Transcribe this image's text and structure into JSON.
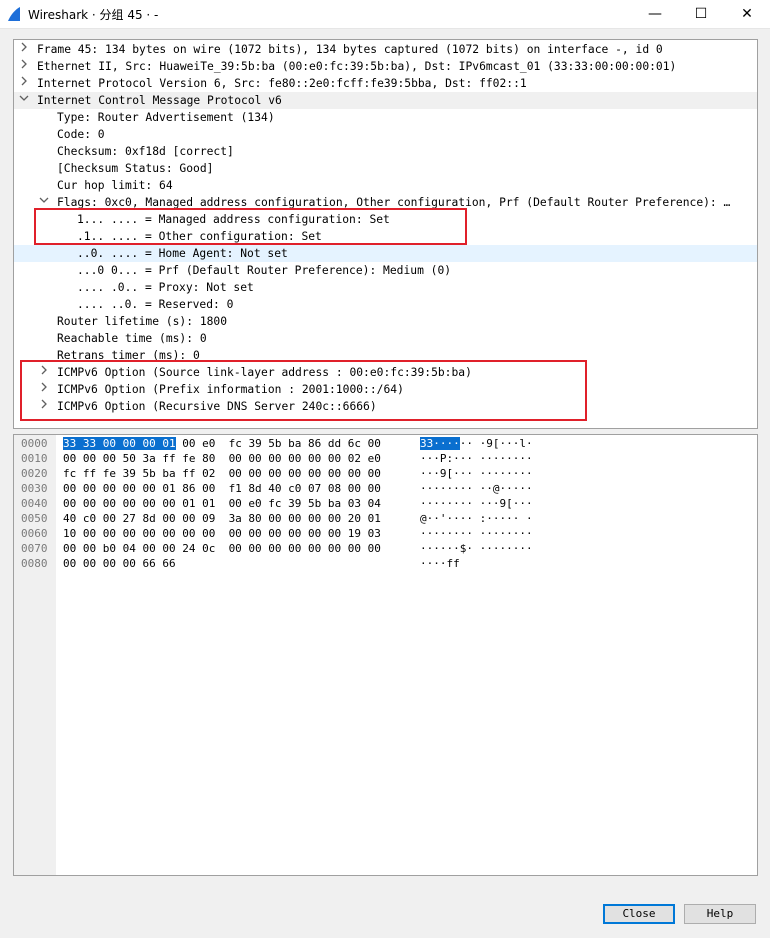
{
  "window": {
    "title": "Wireshark · 分组 45 · -",
    "minimize": "—",
    "maximize": "☐",
    "close": "✕",
    "icon": "wireshark-fin-icon",
    "icon_color": "#1e6fd9"
  },
  "tree": [
    {
      "text": "Frame 45: 134 bytes on wire (1072 bits), 134 bytes captured (1072 bits) on interface -, id 0",
      "expander": "collapsed"
    },
    {
      "text": "Ethernet II, Src: HuaweiTe_39:5b:ba (00:e0:fc:39:5b:ba), Dst: IPv6mcast_01 (33:33:00:00:00:01)",
      "expander": "collapsed"
    },
    {
      "text": "Internet Protocol Version 6, Src: fe80::2e0:fcff:fe39:5bba, Dst: ff02::1",
      "expander": "collapsed"
    },
    {
      "text": "Internet Control Message Protocol v6",
      "expander": "expanded"
    },
    {
      "text": "Type: Router Advertisement (134)",
      "expander": "none"
    },
    {
      "text": "Code: 0",
      "expander": "none"
    },
    {
      "text": "Checksum: 0xf18d [correct]",
      "expander": "none"
    },
    {
      "text": "[Checksum Status: Good]",
      "expander": "none"
    },
    {
      "text": "Cur hop limit: 64",
      "expander": "none"
    },
    {
      "text": "Flags: 0xc0, Managed address configuration, Other configuration, Prf (Default Router Preference): …",
      "expander": "expanded"
    },
    {
      "text": "1... .... = Managed address configuration: Set",
      "expander": "none"
    },
    {
      "text": ".1.. .... = Other configuration: Set",
      "expander": "none"
    },
    {
      "text": "..0. .... = Home Agent: Not set",
      "expander": "none"
    },
    {
      "text": "...0 0... = Prf (Default Router Preference): Medium (0)",
      "expander": "none"
    },
    {
      "text": ".... .0.. = Proxy: Not set",
      "expander": "none"
    },
    {
      "text": ".... ..0. = Reserved: 0",
      "expander": "none"
    },
    {
      "text": "Router lifetime (s): 1800",
      "expander": "none"
    },
    {
      "text": "Reachable time (ms): 0",
      "expander": "none"
    },
    {
      "text": "Retrans timer (ms): 0",
      "expander": "none"
    },
    {
      "text": "ICMPv6 Option (Source link-layer address : 00:e0:fc:39:5b:ba)",
      "expander": "collapsed"
    },
    {
      "text": "ICMPv6 Option (Prefix information : 2001:1000::/64)",
      "expander": "collapsed"
    },
    {
      "text": "ICMPv6 Option (Recursive DNS Server 240c::6666)",
      "expander": "collapsed"
    }
  ],
  "hex": [
    {
      "offset": "0000",
      "sel": "33 33 00 00 00 01",
      "bytes": " 00 e0  fc 39 5b ba 86 dd 6c 00",
      "asel": "33····",
      "ascii": "·· ·9[···l·"
    },
    {
      "offset": "0010",
      "sel": "",
      "bytes": "00 00 00 50 3a ff fe 80  00 00 00 00 00 00 02 e0",
      "asel": "",
      "ascii": "···P:··· ········"
    },
    {
      "offset": "0020",
      "sel": "",
      "bytes": "fc ff fe 39 5b ba ff 02  00 00 00 00 00 00 00 00",
      "asel": "",
      "ascii": "···9[··· ········"
    },
    {
      "offset": "0030",
      "sel": "",
      "bytes": "00 00 00 00 00 01 86 00  f1 8d 40 c0 07 08 00 00",
      "asel": "",
      "ascii": "········ ··@·····"
    },
    {
      "offset": "0040",
      "sel": "",
      "bytes": "00 00 00 00 00 00 01 01  00 e0 fc 39 5b ba 03 04",
      "asel": "",
      "ascii": "········ ···9[···"
    },
    {
      "offset": "0050",
      "sel": "",
      "bytes": "40 c0 00 27 8d 00 00 09  3a 80 00 00 00 00 20 01",
      "asel": "",
      "ascii": "@··'···· :····· ·"
    },
    {
      "offset": "0060",
      "sel": "",
      "bytes": "10 00 00 00 00 00 00 00  00 00 00 00 00 00 19 03",
      "asel": "",
      "ascii": "········ ········"
    },
    {
      "offset": "0070",
      "sel": "",
      "bytes": "00 00 b0 04 00 00 24 0c  00 00 00 00 00 00 00 00",
      "asel": "",
      "ascii": "······$· ········"
    },
    {
      "offset": "0080",
      "sel": "",
      "bytes": "00 00 00 00 66 66",
      "asel": "",
      "ascii": "····ff"
    }
  ],
  "buttons": {
    "close": "Close",
    "help": "Help"
  },
  "colors": {
    "annotation_box": "#e0202a",
    "selection": "#0a6fcf",
    "row_highlight": "#e5f3ff"
  }
}
